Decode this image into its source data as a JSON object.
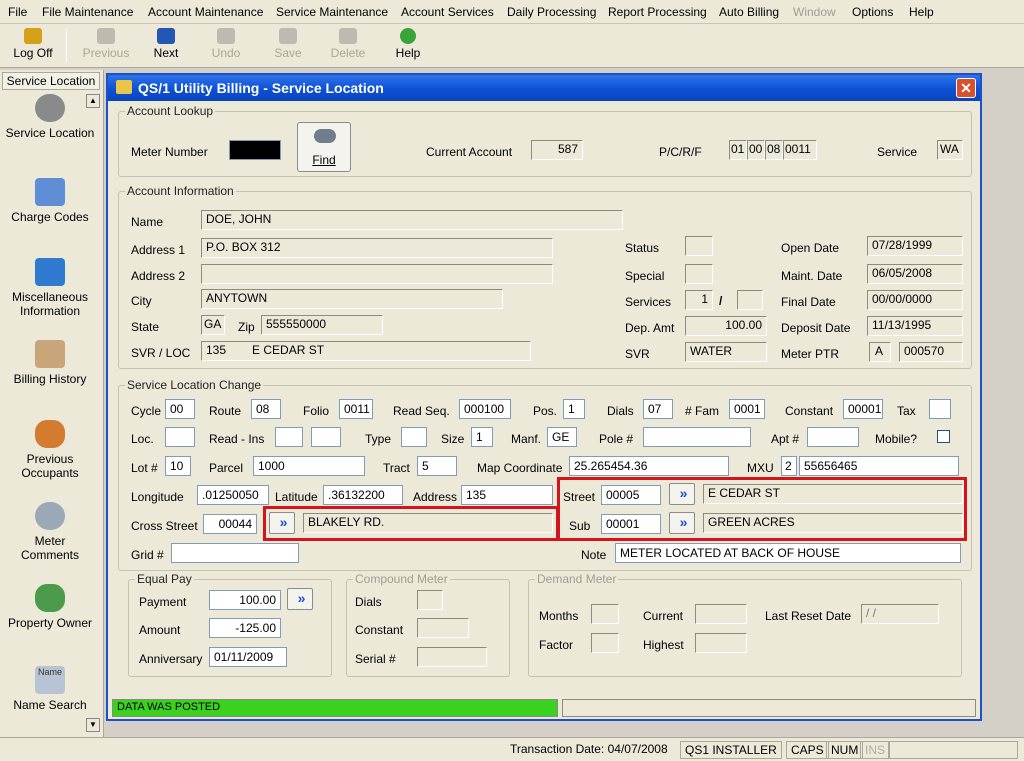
{
  "menu": [
    "File",
    "File Maintenance",
    "Account Maintenance",
    "Service Maintenance",
    "Account Services",
    "Daily Processing",
    "Report Processing",
    "Auto Billing",
    "Window",
    "Options",
    "Help"
  ],
  "toolbar": {
    "logoff": "Log Off",
    "previous": "Previous",
    "next": "Next",
    "undo": "Undo",
    "save": "Save",
    "delete": "Delete",
    "help": "Help"
  },
  "sidebar": {
    "title": "Service Location",
    "items": [
      "Service Location",
      "Charge Codes",
      "Miscellaneous Information",
      "Billing History",
      "Previous Occupants",
      "Meter Comments",
      "Property Owner",
      "Name Search"
    ],
    "name_icon_text": "Name"
  },
  "dialog": {
    "title": "QS/1 Utility Billing - Service Location",
    "lookup": {
      "group": "Account Lookup",
      "meter_number_label": "Meter Number",
      "find_label": "Find",
      "current_account_label": "Current Account",
      "current_account": "587",
      "pcrf_label": "P/C/R/F",
      "pcrf": [
        "01",
        "00",
        "08",
        "0011"
      ],
      "service_label": "Service",
      "service": "WA"
    },
    "info": {
      "group": "Account Information",
      "name_label": "Name",
      "name": "DOE, JOHN",
      "address1_label": "Address 1",
      "address1": "P.O. BOX 312",
      "address2_label": "Address 2",
      "address2": "",
      "city_label": "City",
      "city": "ANYTOWN",
      "state_label": "State",
      "state": "GA",
      "zip_label": "Zip",
      "zip": "555550000",
      "svrloc_label": "SVR / LOC",
      "svr_no": "135",
      "svr_street": "E CEDAR ST",
      "status_label": "Status",
      "status": "",
      "special_label": "Special",
      "special": "",
      "services_label": "Services",
      "services_a": "1",
      "services_sep": "/",
      "services_b": "",
      "depamt_label": "Dep. Amt",
      "depamt": "100.00",
      "svr_label": "SVR",
      "svr": "WATER",
      "open_label": "Open Date",
      "open": "07/28/1999",
      "maint_label": "Maint. Date",
      "maint": "06/05/2008",
      "final_label": "Final Date",
      "final": "00/00/0000",
      "deposit_label": "Deposit Date",
      "deposit": "11/13/1995",
      "meterptr_label": "Meter PTR",
      "meterptr_a": "A",
      "meterptr_b": "000570"
    },
    "change": {
      "group": "Service Location Change",
      "cycle_label": "Cycle",
      "cycle": "00",
      "route_label": "Route",
      "route": "08",
      "folio_label": "Folio",
      "folio": "0011",
      "readseq_label": "Read Seq.",
      "readseq": "000100",
      "pos_label": "Pos.",
      "pos": "1",
      "dials_label": "Dials",
      "dials": "07",
      "fam_label": "# Fam",
      "fam": "0001",
      "constant_label": "Constant",
      "constant": "00001",
      "tax_label": "Tax",
      "tax": "",
      "loc_label": "Loc.",
      "readins_label": "Read - Ins",
      "type_label": "Type",
      "size_label": "Size",
      "size": "1",
      "manf_label": "Manf.",
      "manf": "GE",
      "pole_label": "Pole #",
      "apt_label": "Apt #",
      "mobile_label": "Mobile?",
      "lot_label": "Lot #",
      "lot": "10",
      "parcel_label": "Parcel",
      "parcel": "1000",
      "tract_label": "Tract",
      "tract": "5",
      "map_label": "Map Coordinate",
      "map": "25.265454.36",
      "mxu_label": "MXU",
      "mxu_a": "2",
      "mxu_b": "55656465",
      "lon_label": "Longitude",
      "lon": ".01250050",
      "lat_label": "Latitude",
      "lat": ".36132200",
      "address_label": "Address",
      "address": "135",
      "street_label": "Street",
      "street_code": "00005",
      "street_name": "E CEDAR ST",
      "cross_label": "Cross Street",
      "cross_code": "00044",
      "cross_name": "BLAKELY RD.",
      "sub_label": "Sub",
      "sub_code": "00001",
      "sub_name": "GREEN ACRES",
      "grid_label": "Grid #",
      "note_label": "Note",
      "note": "METER LOCATED AT BACK OF HOUSE"
    },
    "equal_pay": {
      "group": "Equal Pay",
      "payment_label": "Payment",
      "payment": "100.00",
      "amount_label": "Amount",
      "amount": "-125.00",
      "anniv_label": "Anniversary",
      "anniv": "01/11/2009"
    },
    "compound": {
      "group": "Compound Meter",
      "dials_label": "Dials",
      "constant_label": "Constant",
      "serial_label": "Serial #"
    },
    "demand": {
      "group": "Demand Meter",
      "months_label": "Months",
      "current_label": "Current",
      "lastreset_label": "Last Reset Date",
      "lastreset": " /  /",
      "factor_label": "Factor",
      "highest_label": "Highest"
    },
    "status_message": "DATA WAS POSTED"
  },
  "statusbar": {
    "transaction": "Transaction Date: 04/07/2008",
    "user": "QS1 INSTALLER",
    "caps": "CAPS",
    "num": "NUM",
    "ins": "INS"
  }
}
